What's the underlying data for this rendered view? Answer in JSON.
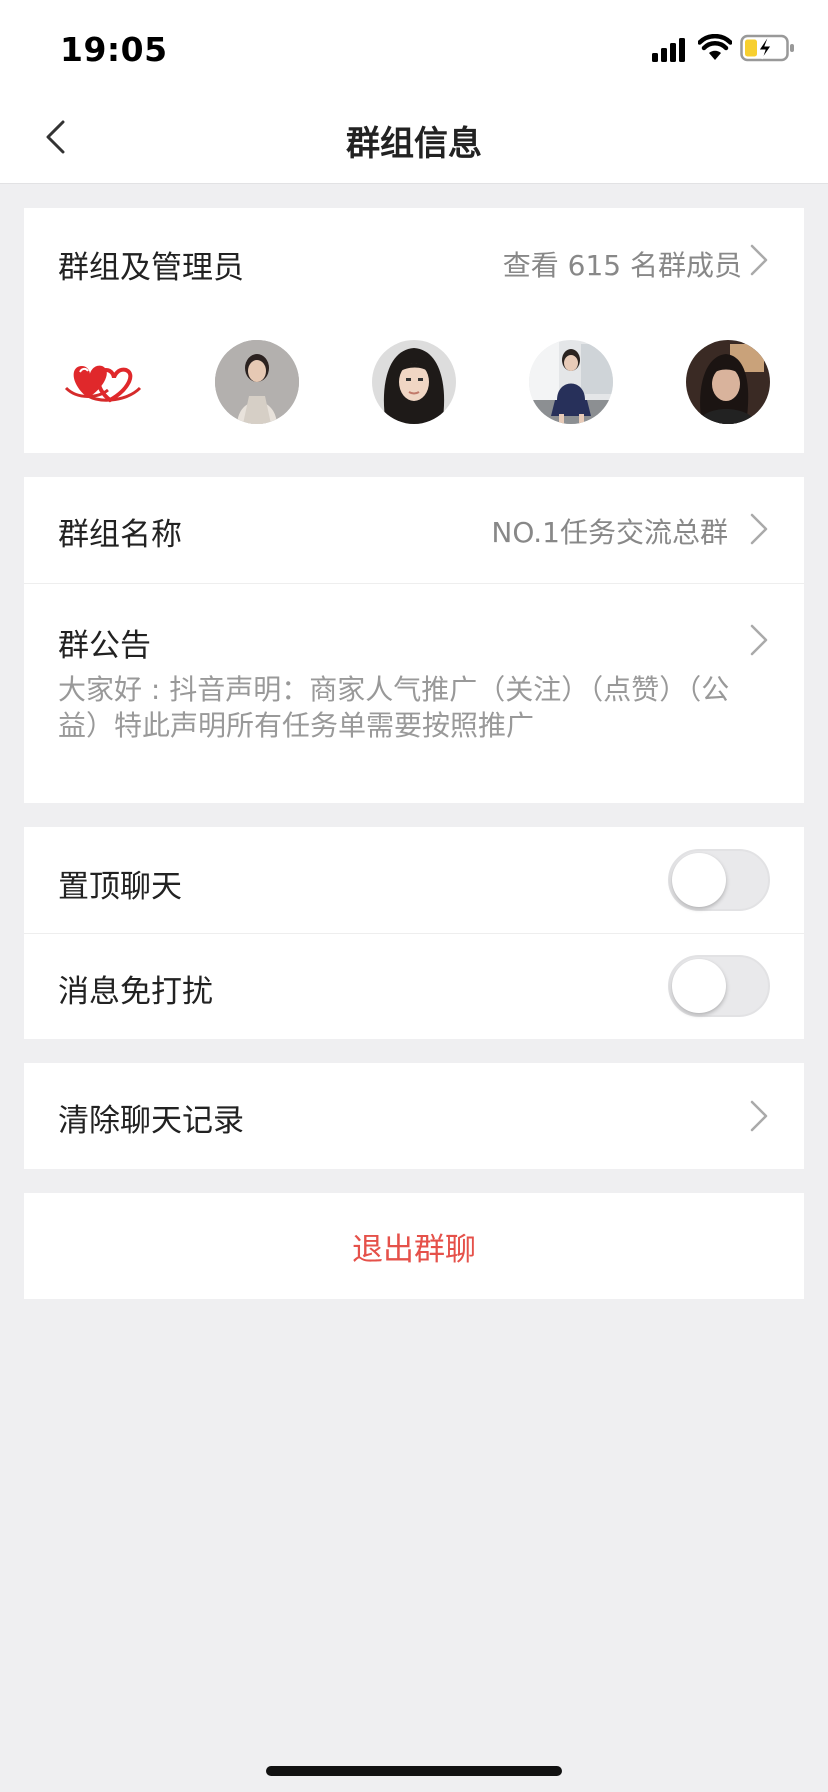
{
  "status_bar": {
    "time": "19:05",
    "icons": [
      "signal-icon",
      "wifi-icon",
      "battery-charging-icon"
    ]
  },
  "nav": {
    "back_icon": "chevron-left-icon",
    "title": "群组信息"
  },
  "members": {
    "label": "群组及管理员",
    "view_all": "查看 615 名群成员",
    "avatars": [
      {
        "name": "hearts-avatar"
      },
      {
        "name": "member-avatar-2"
      },
      {
        "name": "member-avatar-3"
      },
      {
        "name": "member-avatar-4"
      },
      {
        "name": "member-avatar-5"
      }
    ]
  },
  "group_name": {
    "label": "群组名称",
    "value": "NO.1任务交流总群"
  },
  "notice": {
    "label": "群公告",
    "text": "大家好 : 抖音声明：商家人气推广（关注）（点赞）（公益）特此声明所有任务单需要按照推广"
  },
  "settings": {
    "pin_chat": {
      "label": "置顶聊天",
      "on": false
    },
    "mute": {
      "label": "消息免打扰",
      "on": false
    }
  },
  "clear_history": {
    "label": "清除聊天记录"
  },
  "exit": {
    "label": "退出群聊",
    "color": "#e5514a"
  },
  "colors": {
    "background": "#efeff1",
    "accent_red": "#e5514a",
    "battery_yellow": "#f7cf2f"
  }
}
